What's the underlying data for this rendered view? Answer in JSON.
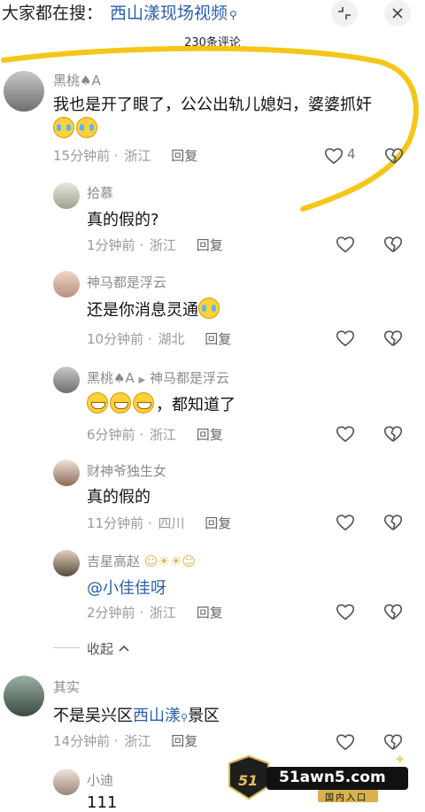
{
  "header": {
    "search_prefix": "大家都在搜：",
    "search_term": "西山漾现场视频",
    "comment_count": "230条评论"
  },
  "comments": [
    {
      "user": "黑桃♠A",
      "text": "我也是开了眼了，公公出轨儿媳妇，婆婆抓奸",
      "time": "15分钟前",
      "location": "浙江",
      "reply": "回复",
      "likes": "4"
    },
    {
      "user": "拾慕",
      "text": "真的假的?",
      "time": "1分钟前",
      "location": "浙江",
      "reply": "回复"
    },
    {
      "user": "神马都是浮云",
      "text": "还是你消息灵通",
      "time": "10分钟前",
      "location": "湖北",
      "reply": "回复"
    },
    {
      "user": "黑桃♠A",
      "reply_to": "神马都是浮云",
      "text": "，都知道了",
      "time": "6分钟前",
      "location": "浙江",
      "reply": "回复"
    },
    {
      "user": "财神爷独生女",
      "text": "真的假的",
      "time": "11分钟前",
      "location": "四川",
      "reply": "回复"
    },
    {
      "user": "吉星高赵",
      "text": "@小佳佳呀",
      "time": "2分钟前",
      "location": "浙江",
      "reply": "回复"
    },
    {
      "user": "其实",
      "text_before": "不是吴兴区",
      "text_link": "西山漾",
      "text_after": "景区",
      "time": "14分钟前",
      "location": "浙江",
      "reply": "回复"
    },
    {
      "user": "小迪",
      "text": "111"
    }
  ],
  "collapse_label": "收起",
  "separator": "·",
  "watermark": {
    "badge": "51",
    "site": "51awn5.com",
    "sub": "国内入口"
  },
  "colors": {
    "link": "#2b5fb0",
    "highlight_stroke": "#f5c518"
  },
  "icons": [
    "compress-icon",
    "close-icon",
    "heart-icon",
    "dislike-heart-icon",
    "chevron-up-icon",
    "search-small-icon"
  ]
}
